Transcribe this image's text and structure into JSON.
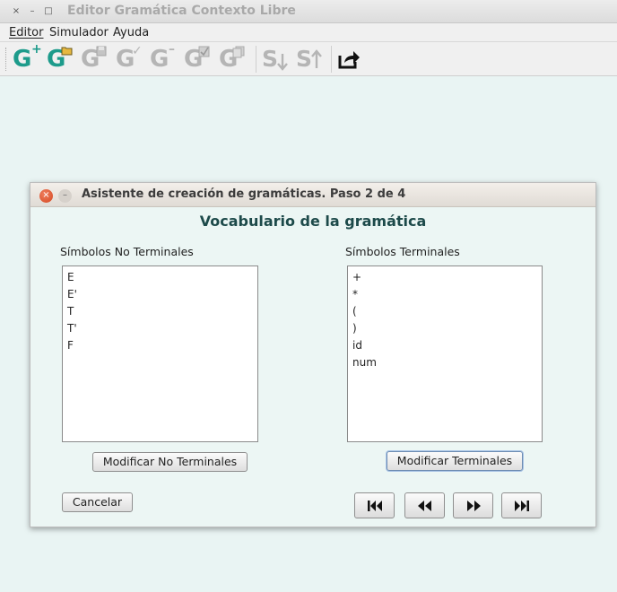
{
  "window": {
    "title": "Editor Gramática Contexto Libre"
  },
  "menu": {
    "items": [
      {
        "label": "Editor",
        "mnemonic": "E"
      },
      {
        "label": "Simulador",
        "mnemonic": "S"
      },
      {
        "label": "Ayuda",
        "mnemonic": ""
      }
    ]
  },
  "toolbar": {
    "icons": [
      "new-grammar-icon",
      "open-grammar-icon",
      "save-grammar-icon",
      "check-grammar-icon",
      "delete-grammar-icon",
      "validate-grammar-icon",
      "copy-grammar-icon",
      "first-sets-icon",
      "follow-sets-icon",
      "export-icon"
    ],
    "colors": {
      "active": "#1d9b8b",
      "disabled": "#b5b5b5",
      "export": "#111111"
    }
  },
  "dialog": {
    "title": "Asistente de creación de gramáticas. Paso 2 de 4",
    "heading": "Vocabulario de la gramática",
    "non_terminals": {
      "label": "Símbolos No Terminales",
      "items": [
        "E",
        "E'",
        "T",
        "T'",
        "F"
      ],
      "button": "Modificar No Terminales"
    },
    "terminals": {
      "label": "Símbolos Terminales",
      "items": [
        "+",
        "*",
        "(",
        ")",
        "id",
        "num"
      ],
      "button": "Modificar Terminales"
    },
    "cancel_label": "Cancelar",
    "nav_icons": [
      "first-step-icon",
      "previous-step-icon",
      "next-step-icon",
      "last-step-icon"
    ]
  }
}
